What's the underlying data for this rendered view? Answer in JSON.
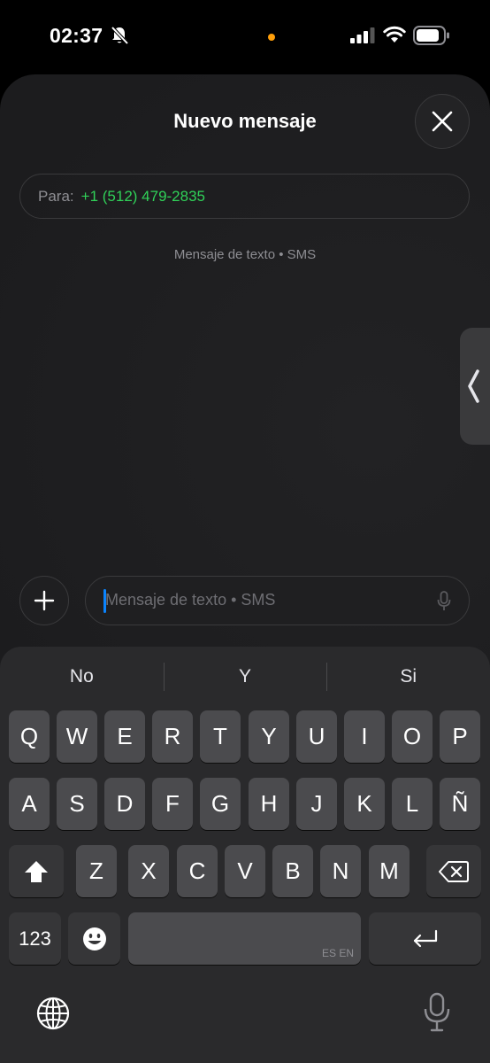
{
  "status_bar": {
    "time": "02:37",
    "icons": [
      "bell-slash-icon",
      "signal-icon",
      "wifi-icon",
      "battery-icon"
    ],
    "privacy_dot_color": "#ff9f0a"
  },
  "header": {
    "title": "Nuevo mensaje",
    "close_icon": "close-icon"
  },
  "recipient": {
    "label": "Para:",
    "value": "+1 (512) 479-2835",
    "value_color": "#30d158"
  },
  "service_caption": "Mensaje de texto • SMS",
  "compose": {
    "add_icon": "plus-icon",
    "placeholder": "Mensaje de texto • SMS",
    "mic_icon": "microphone-icon",
    "cursor_color": "#0a84ff"
  },
  "keyboard": {
    "suggestions": [
      "No",
      "Y",
      "Si"
    ],
    "row1": [
      "Q",
      "W",
      "E",
      "R",
      "T",
      "Y",
      "U",
      "I",
      "O",
      "P"
    ],
    "row2": [
      "A",
      "S",
      "D",
      "F",
      "G",
      "H",
      "J",
      "K",
      "L",
      "Ñ"
    ],
    "row3": [
      "Z",
      "X",
      "C",
      "V",
      "B",
      "N",
      "M"
    ],
    "numbers_key": "123",
    "space_language": "ES EN",
    "icons": [
      "shift-icon",
      "delete-icon",
      "emoji-icon",
      "return-icon",
      "globe-icon",
      "dictation-icon"
    ]
  }
}
